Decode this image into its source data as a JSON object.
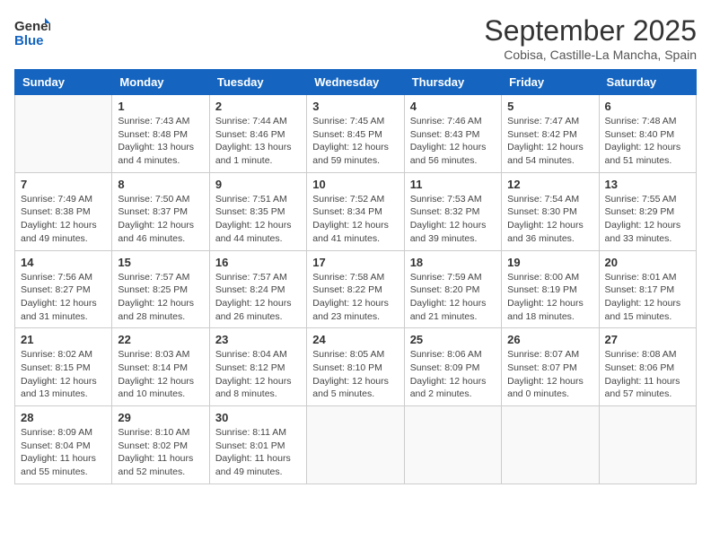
{
  "header": {
    "logo": {
      "line1": "General",
      "line2": "Blue"
    },
    "title": "September 2025",
    "location": "Cobisa, Castille-La Mancha, Spain"
  },
  "weekdays": [
    "Sunday",
    "Monday",
    "Tuesday",
    "Wednesday",
    "Thursday",
    "Friday",
    "Saturday"
  ],
  "weeks": [
    [
      {
        "day": "",
        "info": ""
      },
      {
        "day": "1",
        "info": "Sunrise: 7:43 AM\nSunset: 8:48 PM\nDaylight: 13 hours\nand 4 minutes."
      },
      {
        "day": "2",
        "info": "Sunrise: 7:44 AM\nSunset: 8:46 PM\nDaylight: 13 hours\nand 1 minute."
      },
      {
        "day": "3",
        "info": "Sunrise: 7:45 AM\nSunset: 8:45 PM\nDaylight: 12 hours\nand 59 minutes."
      },
      {
        "day": "4",
        "info": "Sunrise: 7:46 AM\nSunset: 8:43 PM\nDaylight: 12 hours\nand 56 minutes."
      },
      {
        "day": "5",
        "info": "Sunrise: 7:47 AM\nSunset: 8:42 PM\nDaylight: 12 hours\nand 54 minutes."
      },
      {
        "day": "6",
        "info": "Sunrise: 7:48 AM\nSunset: 8:40 PM\nDaylight: 12 hours\nand 51 minutes."
      }
    ],
    [
      {
        "day": "7",
        "info": "Sunrise: 7:49 AM\nSunset: 8:38 PM\nDaylight: 12 hours\nand 49 minutes."
      },
      {
        "day": "8",
        "info": "Sunrise: 7:50 AM\nSunset: 8:37 PM\nDaylight: 12 hours\nand 46 minutes."
      },
      {
        "day": "9",
        "info": "Sunrise: 7:51 AM\nSunset: 8:35 PM\nDaylight: 12 hours\nand 44 minutes."
      },
      {
        "day": "10",
        "info": "Sunrise: 7:52 AM\nSunset: 8:34 PM\nDaylight: 12 hours\nand 41 minutes."
      },
      {
        "day": "11",
        "info": "Sunrise: 7:53 AM\nSunset: 8:32 PM\nDaylight: 12 hours\nand 39 minutes."
      },
      {
        "day": "12",
        "info": "Sunrise: 7:54 AM\nSunset: 8:30 PM\nDaylight: 12 hours\nand 36 minutes."
      },
      {
        "day": "13",
        "info": "Sunrise: 7:55 AM\nSunset: 8:29 PM\nDaylight: 12 hours\nand 33 minutes."
      }
    ],
    [
      {
        "day": "14",
        "info": "Sunrise: 7:56 AM\nSunset: 8:27 PM\nDaylight: 12 hours\nand 31 minutes."
      },
      {
        "day": "15",
        "info": "Sunrise: 7:57 AM\nSunset: 8:25 PM\nDaylight: 12 hours\nand 28 minutes."
      },
      {
        "day": "16",
        "info": "Sunrise: 7:57 AM\nSunset: 8:24 PM\nDaylight: 12 hours\nand 26 minutes."
      },
      {
        "day": "17",
        "info": "Sunrise: 7:58 AM\nSunset: 8:22 PM\nDaylight: 12 hours\nand 23 minutes."
      },
      {
        "day": "18",
        "info": "Sunrise: 7:59 AM\nSunset: 8:20 PM\nDaylight: 12 hours\nand 21 minutes."
      },
      {
        "day": "19",
        "info": "Sunrise: 8:00 AM\nSunset: 8:19 PM\nDaylight: 12 hours\nand 18 minutes."
      },
      {
        "day": "20",
        "info": "Sunrise: 8:01 AM\nSunset: 8:17 PM\nDaylight: 12 hours\nand 15 minutes."
      }
    ],
    [
      {
        "day": "21",
        "info": "Sunrise: 8:02 AM\nSunset: 8:15 PM\nDaylight: 12 hours\nand 13 minutes."
      },
      {
        "day": "22",
        "info": "Sunrise: 8:03 AM\nSunset: 8:14 PM\nDaylight: 12 hours\nand 10 minutes."
      },
      {
        "day": "23",
        "info": "Sunrise: 8:04 AM\nSunset: 8:12 PM\nDaylight: 12 hours\nand 8 minutes."
      },
      {
        "day": "24",
        "info": "Sunrise: 8:05 AM\nSunset: 8:10 PM\nDaylight: 12 hours\nand 5 minutes."
      },
      {
        "day": "25",
        "info": "Sunrise: 8:06 AM\nSunset: 8:09 PM\nDaylight: 12 hours\nand 2 minutes."
      },
      {
        "day": "26",
        "info": "Sunrise: 8:07 AM\nSunset: 8:07 PM\nDaylight: 12 hours\nand 0 minutes."
      },
      {
        "day": "27",
        "info": "Sunrise: 8:08 AM\nSunset: 8:06 PM\nDaylight: 11 hours\nand 57 minutes."
      }
    ],
    [
      {
        "day": "28",
        "info": "Sunrise: 8:09 AM\nSunset: 8:04 PM\nDaylight: 11 hours\nand 55 minutes."
      },
      {
        "day": "29",
        "info": "Sunrise: 8:10 AM\nSunset: 8:02 PM\nDaylight: 11 hours\nand 52 minutes."
      },
      {
        "day": "30",
        "info": "Sunrise: 8:11 AM\nSunset: 8:01 PM\nDaylight: 11 hours\nand 49 minutes."
      },
      {
        "day": "",
        "info": ""
      },
      {
        "day": "",
        "info": ""
      },
      {
        "day": "",
        "info": ""
      },
      {
        "day": "",
        "info": ""
      }
    ]
  ]
}
